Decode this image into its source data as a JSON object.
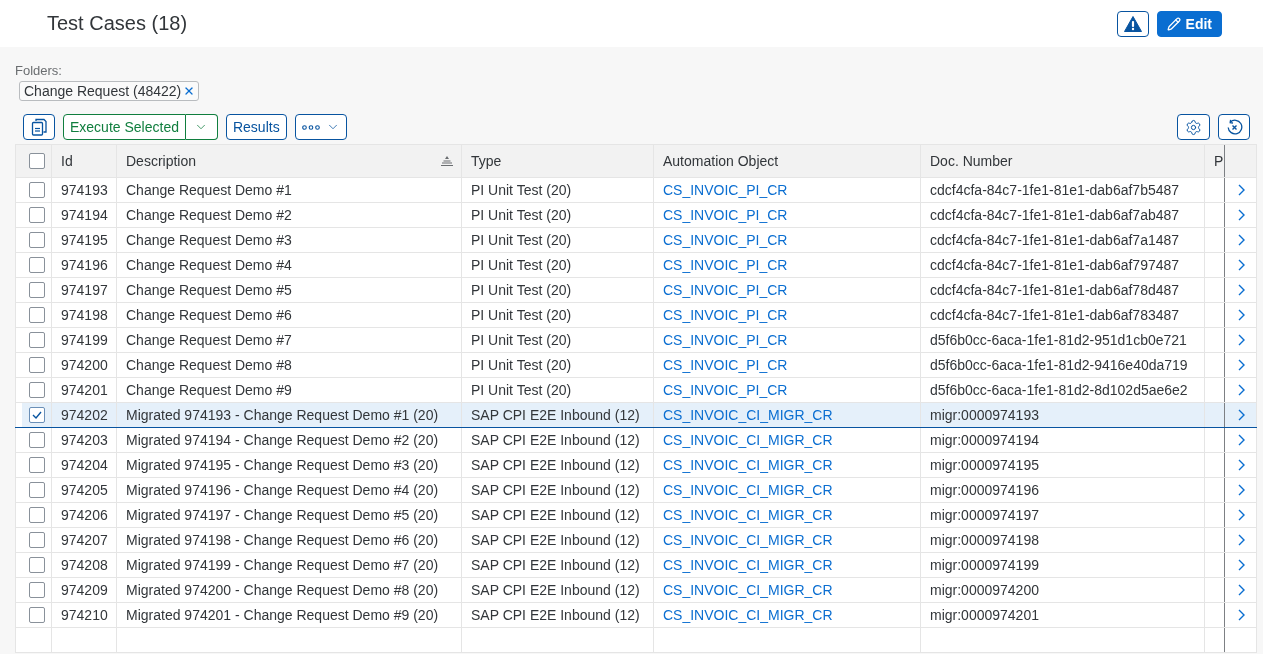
{
  "header": {
    "title": "Test Cases (18)",
    "edit_button": {
      "label": "Edit"
    }
  },
  "folders": {
    "label": "Folders:",
    "tokens": [
      {
        "text": "Change Request (48422)"
      }
    ]
  },
  "toolbar": {
    "execute_button": {
      "label": "Execute Selected"
    },
    "results_button": {
      "label": "Results"
    }
  },
  "table": {
    "select_all": {
      "checked": false
    },
    "columns": [
      {
        "label": "Id",
        "sorted": false
      },
      {
        "label": "Description",
        "sorted": true
      },
      {
        "label": "Type",
        "sorted": false
      },
      {
        "label": "Automation Object",
        "sorted": false
      },
      {
        "label": "Doc. Number",
        "sorted": false
      },
      {
        "label": "P",
        "sorted": false
      }
    ],
    "rows": [
      {
        "id": "974193",
        "description": "Change Request Demo #1",
        "type": "PI Unit Test (20)",
        "automation_object": "CS_INVOIC_PI_CR",
        "doc_number": "cdcf4cfa-84c7-1fe1-81e1-dab6af7b5487",
        "selected": false
      },
      {
        "id": "974194",
        "description": "Change Request Demo #2",
        "type": "PI Unit Test (20)",
        "automation_object": "CS_INVOIC_PI_CR",
        "doc_number": "cdcf4cfa-84c7-1fe1-81e1-dab6af7ab487",
        "selected": false
      },
      {
        "id": "974195",
        "description": "Change Request Demo #3",
        "type": "PI Unit Test (20)",
        "automation_object": "CS_INVOIC_PI_CR",
        "doc_number": "cdcf4cfa-84c7-1fe1-81e1-dab6af7a1487",
        "selected": false
      },
      {
        "id": "974196",
        "description": "Change Request Demo #4",
        "type": "PI Unit Test (20)",
        "automation_object": "CS_INVOIC_PI_CR",
        "doc_number": "cdcf4cfa-84c7-1fe1-81e1-dab6af797487",
        "selected": false
      },
      {
        "id": "974197",
        "description": "Change Request Demo #5",
        "type": "PI Unit Test (20)",
        "automation_object": "CS_INVOIC_PI_CR",
        "doc_number": "cdcf4cfa-84c7-1fe1-81e1-dab6af78d487",
        "selected": false
      },
      {
        "id": "974198",
        "description": "Change Request Demo #6",
        "type": "PI Unit Test (20)",
        "automation_object": "CS_INVOIC_PI_CR",
        "doc_number": "cdcf4cfa-84c7-1fe1-81e1-dab6af783487",
        "selected": false
      },
      {
        "id": "974199",
        "description": "Change Request Demo #7",
        "type": "PI Unit Test (20)",
        "automation_object": "CS_INVOIC_PI_CR",
        "doc_number": "d5f6b0cc-6aca-1fe1-81d2-951d1cb0e721",
        "selected": false
      },
      {
        "id": "974200",
        "description": "Change Request Demo #8",
        "type": "PI Unit Test (20)",
        "automation_object": "CS_INVOIC_PI_CR",
        "doc_number": "d5f6b0cc-6aca-1fe1-81d2-9416e40da719",
        "selected": false
      },
      {
        "id": "974201",
        "description": "Change Request Demo #9",
        "type": "PI Unit Test (20)",
        "automation_object": "CS_INVOIC_PI_CR",
        "doc_number": "d5f6b0cc-6aca-1fe1-81d2-8d102d5ae6e2",
        "selected": false
      },
      {
        "id": "974202",
        "description": "Migrated 974193 - Change Request Demo #1 (20)",
        "type": "SAP CPI E2E Inbound (12)",
        "automation_object": "CS_INVOIC_CI_MIGR_CR",
        "doc_number": "migr:0000974193",
        "selected": true
      },
      {
        "id": "974203",
        "description": "Migrated 974194 - Change Request Demo #2 (20)",
        "type": "SAP CPI E2E Inbound (12)",
        "automation_object": "CS_INVOIC_CI_MIGR_CR",
        "doc_number": "migr:0000974194",
        "selected": false
      },
      {
        "id": "974204",
        "description": "Migrated 974195 - Change Request Demo #3 (20)",
        "type": "SAP CPI E2E Inbound (12)",
        "automation_object": "CS_INVOIC_CI_MIGR_CR",
        "doc_number": "migr:0000974195",
        "selected": false
      },
      {
        "id": "974205",
        "description": "Migrated 974196 - Change Request Demo #4 (20)",
        "type": "SAP CPI E2E Inbound (12)",
        "automation_object": "CS_INVOIC_CI_MIGR_CR",
        "doc_number": "migr:0000974196",
        "selected": false
      },
      {
        "id": "974206",
        "description": "Migrated 974197 - Change Request Demo #5 (20)",
        "type": "SAP CPI E2E Inbound (12)",
        "automation_object": "CS_INVOIC_CI_MIGR_CR",
        "doc_number": "migr:0000974197",
        "selected": false
      },
      {
        "id": "974207",
        "description": "Migrated 974198 - Change Request Demo #6 (20)",
        "type": "SAP CPI E2E Inbound (12)",
        "automation_object": "CS_INVOIC_CI_MIGR_CR",
        "doc_number": "migr:0000974198",
        "selected": false
      },
      {
        "id": "974208",
        "description": "Migrated 974199 - Change Request Demo #7 (20)",
        "type": "SAP CPI E2E Inbound (12)",
        "automation_object": "CS_INVOIC_CI_MIGR_CR",
        "doc_number": "migr:0000974199",
        "selected": false
      },
      {
        "id": "974209",
        "description": "Migrated 974200 - Change Request Demo #8 (20)",
        "type": "SAP CPI E2E Inbound (12)",
        "automation_object": "CS_INVOIC_CI_MIGR_CR",
        "doc_number": "migr:0000974200",
        "selected": false
      },
      {
        "id": "974210",
        "description": "Migrated 974201 - Change Request Demo #9 (20)",
        "type": "SAP CPI E2E Inbound (12)",
        "automation_object": "CS_INVOIC_CI_MIGR_CR",
        "doc_number": "migr:0000974201",
        "selected": false
      }
    ]
  }
}
